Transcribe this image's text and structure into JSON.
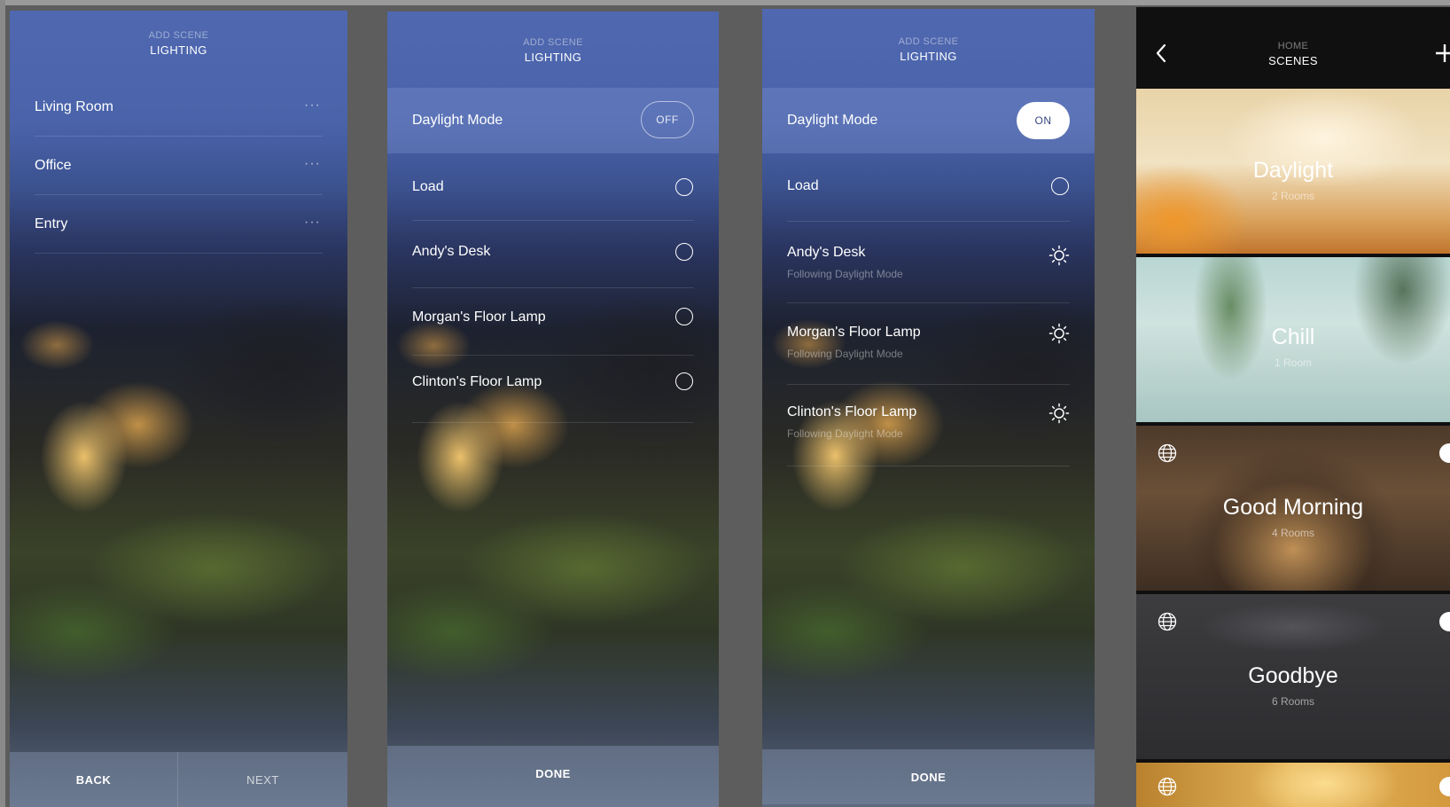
{
  "screen1": {
    "header_small": "ADD SCENE",
    "header_big": "LIGHTING",
    "rooms": [
      {
        "label": "Living Room",
        "more": "···"
      },
      {
        "label": "Office",
        "more": "···"
      },
      {
        "label": "Entry",
        "more": "···"
      }
    ],
    "back_label": "BACK",
    "next_label": "NEXT"
  },
  "screen2": {
    "header_small": "ADD SCENE",
    "header_big": "LIGHTING",
    "daylight_label": "Daylight Mode",
    "daylight_state": "OFF",
    "loads": [
      {
        "label": "Load"
      },
      {
        "label": "Andy's Desk"
      },
      {
        "label": "Morgan's Floor Lamp"
      },
      {
        "label": "Clinton's Floor Lamp"
      }
    ],
    "done_label": "DONE"
  },
  "screen3": {
    "header_small": "ADD SCENE",
    "header_big": "LIGHTING",
    "daylight_label": "Daylight Mode",
    "daylight_state": "ON",
    "loads": [
      {
        "label": "Load",
        "sub": ""
      },
      {
        "label": "Andy's Desk",
        "sub": "Following Daylight Mode"
      },
      {
        "label": "Morgan's Floor Lamp",
        "sub": "Following Daylight Mode"
      },
      {
        "label": "Clinton's Floor Lamp",
        "sub": "Following Daylight Mode"
      }
    ],
    "done_label": "DONE"
  },
  "screen4": {
    "header_small": "HOME",
    "header_big": "SCENES",
    "scenes": [
      {
        "title": "Daylight",
        "count": "2 Rooms"
      },
      {
        "title": "Chill",
        "count": "1 Room"
      },
      {
        "title": "Good Morning",
        "count": "4 Rooms"
      },
      {
        "title": "Goodbye",
        "count": "6 Rooms"
      }
    ]
  },
  "icons": {
    "more": "more-dots-icon",
    "radio": "radio-circle-icon",
    "sun": "sun-icon",
    "back": "chevron-left-icon",
    "add": "plus-icon",
    "globe": "globe-icon",
    "clock": "clock-icon"
  }
}
